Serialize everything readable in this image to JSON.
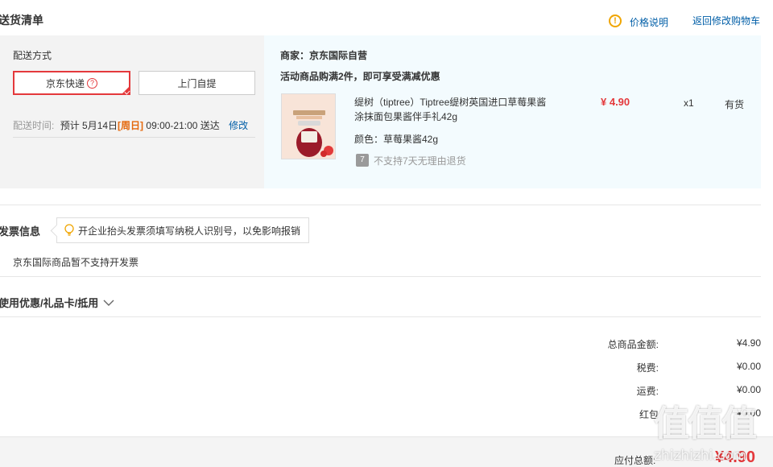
{
  "header": {
    "title": "送货清单",
    "price_note": "价格说明",
    "back_to_cart": "返回修改购物车"
  },
  "shipping": {
    "method_label": "配送方式",
    "options": [
      {
        "label": "京东快递",
        "selected": true
      },
      {
        "label": "上门自提",
        "selected": false
      }
    ],
    "time_label": "配送时间:",
    "time_prefix": "预计 5月14日",
    "time_weekday": "[周日]",
    "time_range": "09:00-21:00 送达",
    "edit": "修改"
  },
  "order": {
    "merchant": "商家：京东国际自营",
    "promo": "活动商品购满2件，即可享受满减优惠",
    "product": {
      "name_line1": "缇树（tiptree）Tiptree缇树英国进口草莓果酱",
      "name_line2": "涂抹面包果酱伴手礼42g",
      "color": "颜色：草莓果酱42g",
      "return_badge": "7",
      "return_policy": "不支持7天无理由退货",
      "price": "¥ 4.90",
      "quantity": "x1",
      "stock": "有货"
    }
  },
  "invoice": {
    "title": "发票信息",
    "tip": "开企业抬头发票须填写纳税人识别号，以免影响报销",
    "note": "京东国际商品暂不支持开发票"
  },
  "coupon": {
    "title": "使用优惠/礼品卡/抵用"
  },
  "summary": {
    "rows": [
      {
        "label": "总商品金额:",
        "value": "¥4.90"
      },
      {
        "label": "税费:",
        "value": "¥0.00"
      },
      {
        "label": "运费:",
        "value": "¥0.00"
      },
      {
        "label": "红包",
        "value": "¥0.00"
      }
    ],
    "payable_label": "应付总额:",
    "payable_value": "¥4.90"
  },
  "watermark": {
    "text": "值值值",
    "url": "zhizhizhi.com"
  },
  "colors": {
    "accent_red": "#e4393c",
    "link_blue": "#005ea7",
    "warn_orange": "#f0a500",
    "weekday_orange": "#e4680c"
  }
}
